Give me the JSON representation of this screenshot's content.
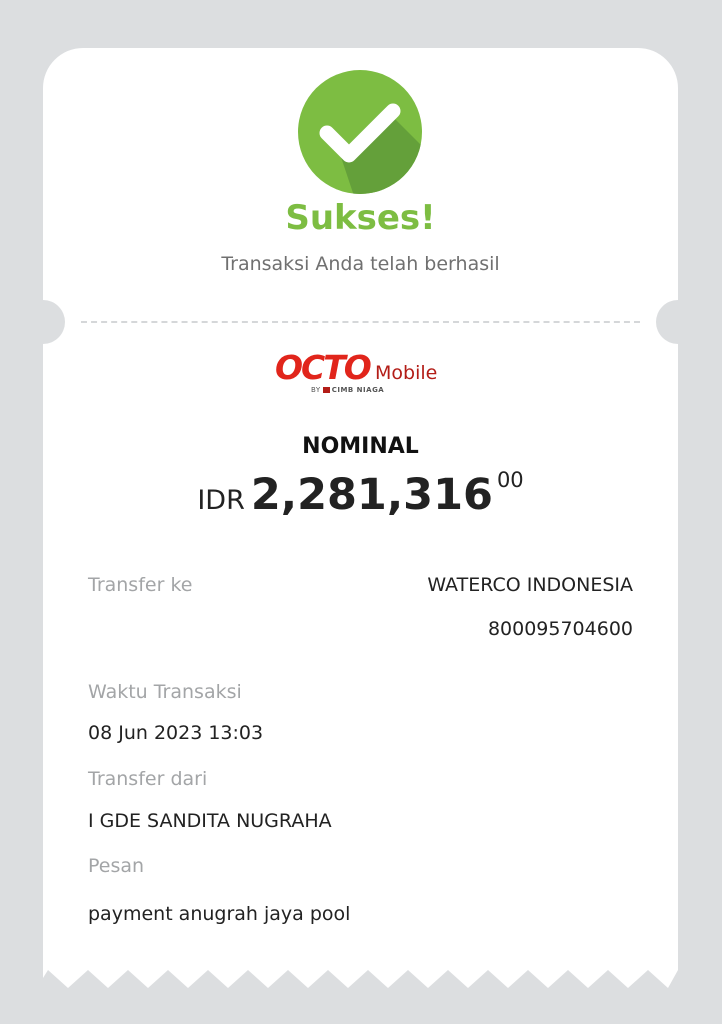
{
  "status": {
    "title": "Sukses!",
    "subtitle": "Transaksi Anda telah berhasil",
    "icon": "check-circle-icon",
    "color": "#7dbd42"
  },
  "logo": {
    "brand": "OCTO",
    "suffix": "Mobile",
    "byline": "BY",
    "partner": "CIMB NIAGA"
  },
  "nominal": {
    "label": "NOMINAL",
    "currency": "IDR",
    "amount": "2,281,316",
    "decimals": "00"
  },
  "transfer_to": {
    "label": "Transfer ke",
    "name": "WATERCO INDONESIA",
    "account": "800095704600"
  },
  "transaction_time": {
    "label": "Waktu Transaksi",
    "value": "08 Jun 2023 13:03"
  },
  "transfer_from": {
    "label": "Transfer dari",
    "value": "I GDE SANDITA NUGRAHA"
  },
  "message": {
    "label": "Pesan",
    "value": "payment anugrah jaya pool"
  }
}
